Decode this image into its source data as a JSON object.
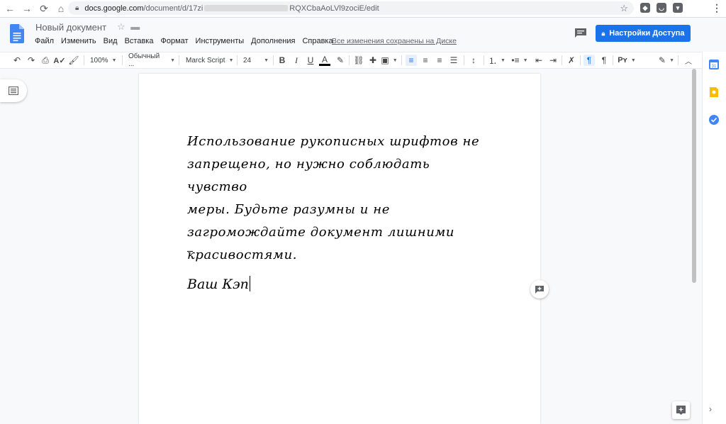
{
  "browser": {
    "url_host": "docs.google.com",
    "url_path_start": "/document/d/17zi",
    "url_path_end": "RQXCbaAoLVl9zociE/edit"
  },
  "doc": {
    "title": "Новый документ",
    "saved_status": "Все изменения сохранены на Диске",
    "share_label": "Настройки Доступа"
  },
  "menu": [
    "Файл",
    "Изменить",
    "Вид",
    "Вставка",
    "Формат",
    "Инструменты",
    "Дополнения",
    "Справка"
  ],
  "toolbar": {
    "zoom": "100%",
    "style": "Обычный ...",
    "font": "Marck Script",
    "size": "24"
  },
  "content": {
    "paragraph_lines": [
      "Использование рукописных шрифтов не",
      "запрещено, но нужно соблюдать чувство",
      "меры. Будьте разумны и не",
      "загромождайте документ лишними",
      "красивостями."
    ],
    "signature": "Ваш Кэп"
  },
  "colors": {
    "accent": "#1a73e8",
    "docs_blue": "#4285f4",
    "keep_yellow": "#fbbc04"
  }
}
